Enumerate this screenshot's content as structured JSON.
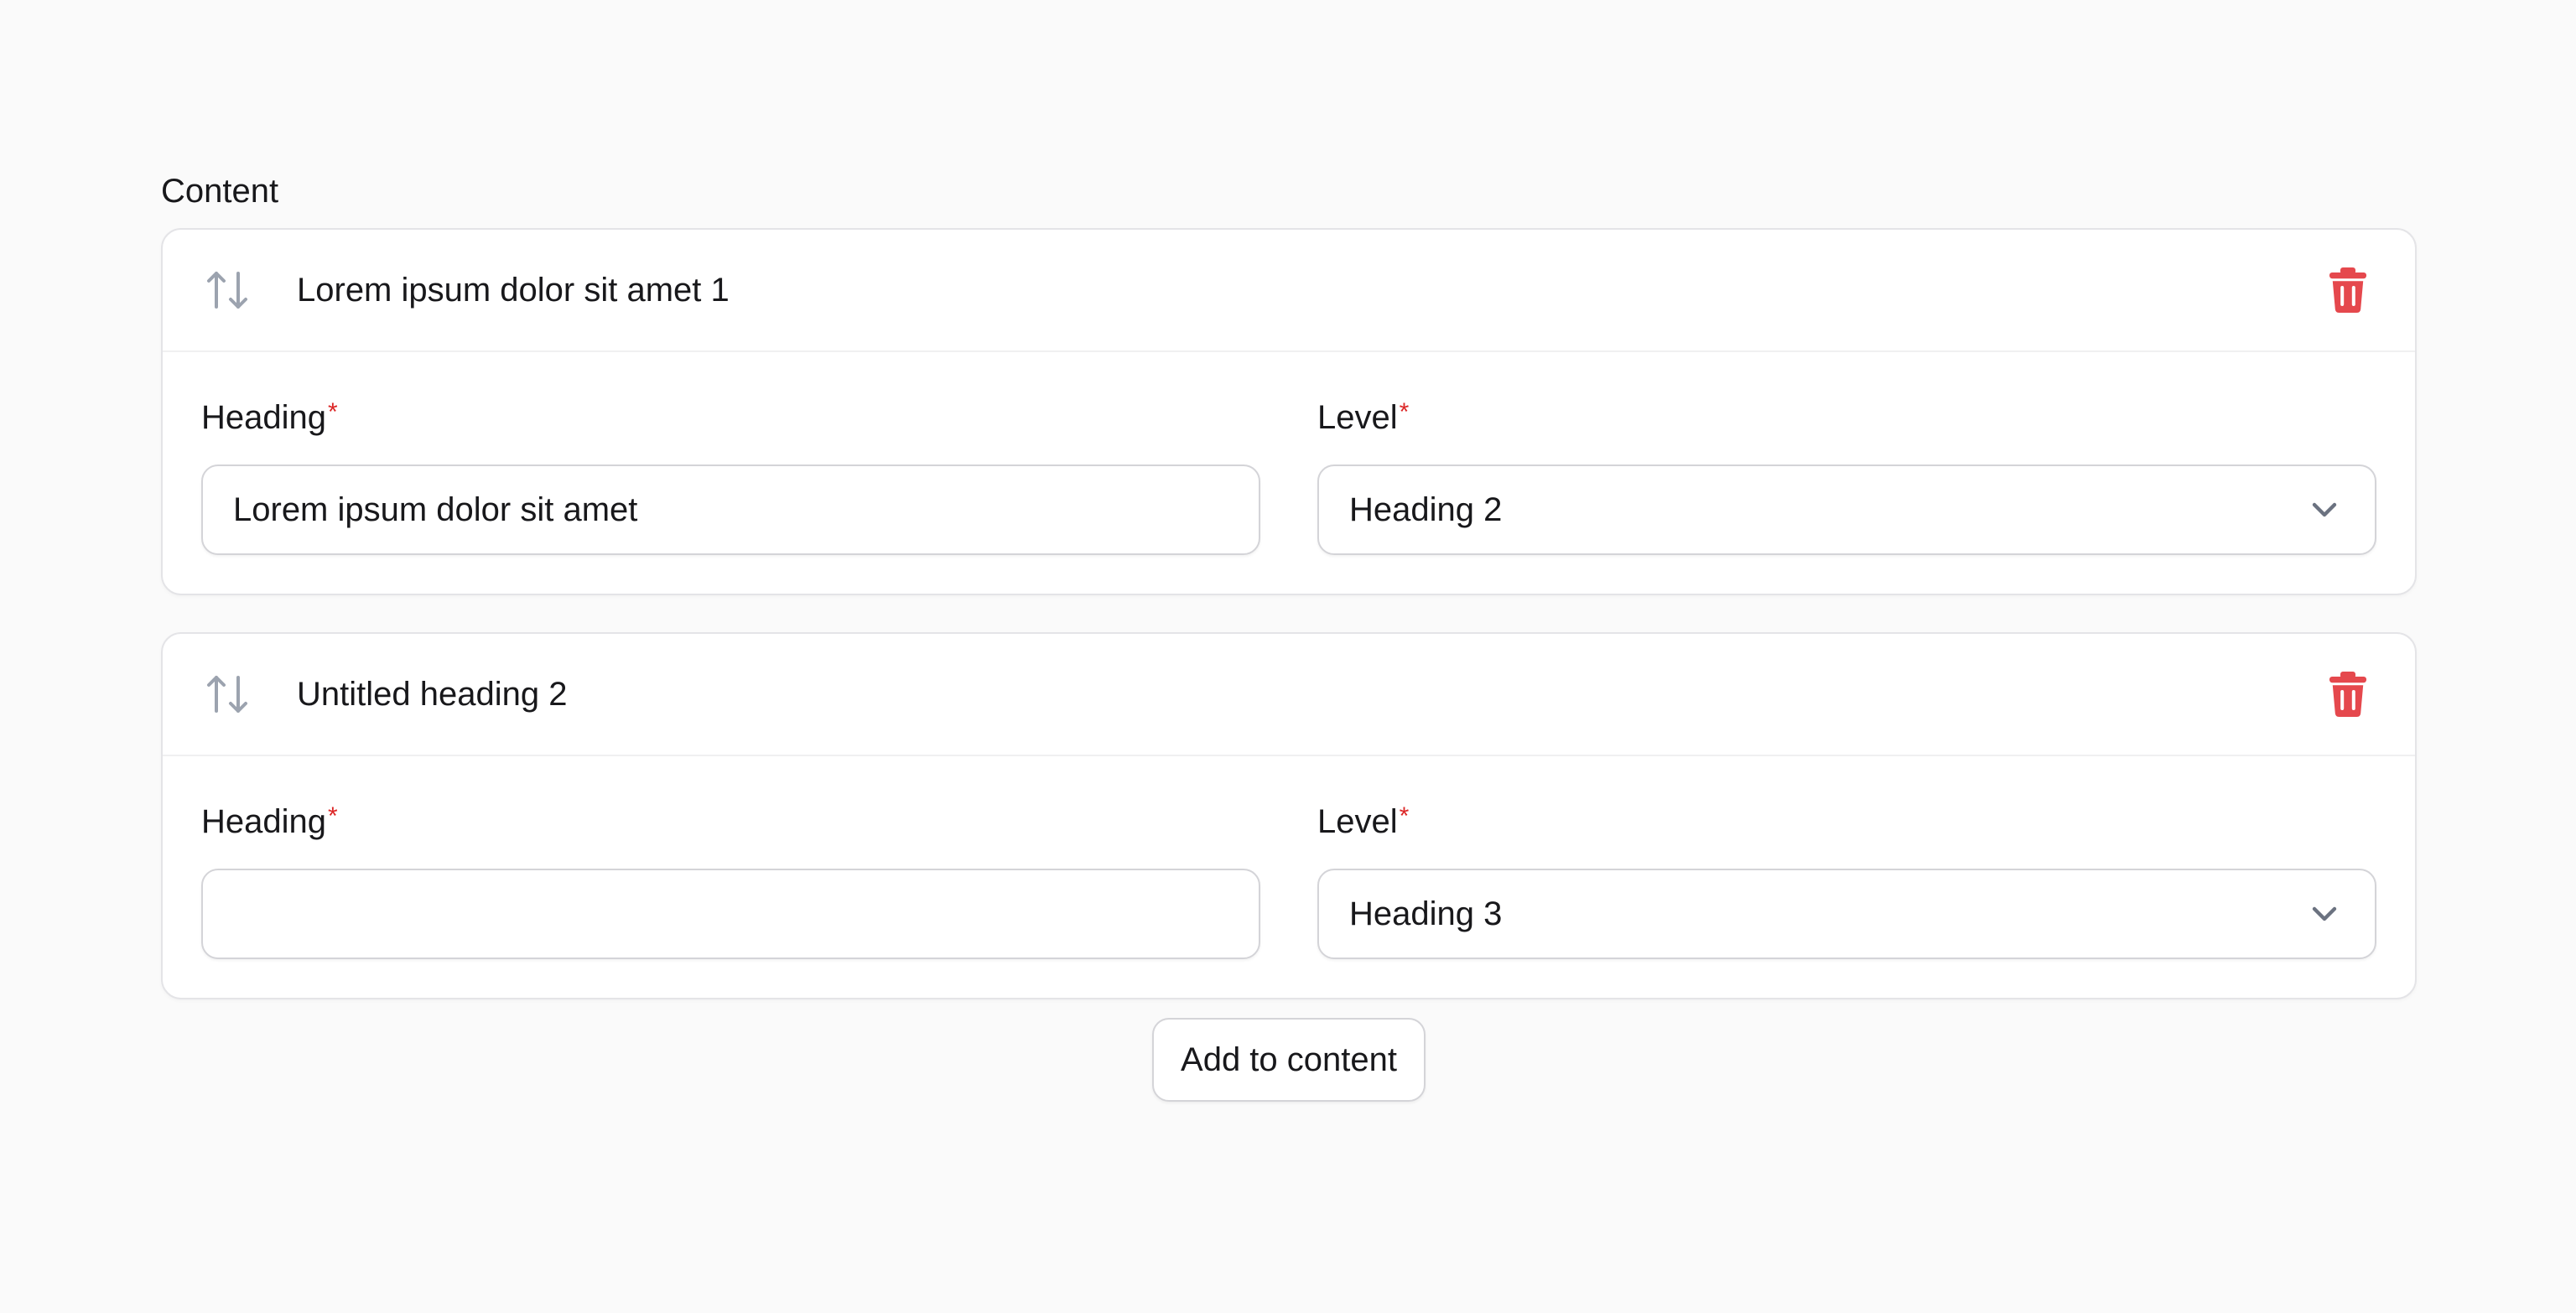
{
  "section": {
    "label": "Content"
  },
  "items": [
    {
      "title": "Lorem ipsum dolor sit amet 1",
      "heading_label": "Heading",
      "heading_value": "Lorem ipsum dolor sit amet",
      "level_label": "Level",
      "level_value": "Heading 2",
      "required_mark": "*"
    },
    {
      "title": "Untitled heading 2",
      "heading_label": "Heading",
      "heading_value": "",
      "level_label": "Level",
      "level_value": "Heading 3",
      "required_mark": "*"
    }
  ],
  "actions": {
    "add_label": "Add to content"
  },
  "icons": {
    "sort": "arrows-up-down-icon",
    "delete": "trash-icon",
    "chevron": "chevron-down-icon"
  },
  "colors": {
    "danger": "#e5484d",
    "required": "#dc2626",
    "icon_gray": "#9ca3af",
    "background": "#fafafa"
  }
}
